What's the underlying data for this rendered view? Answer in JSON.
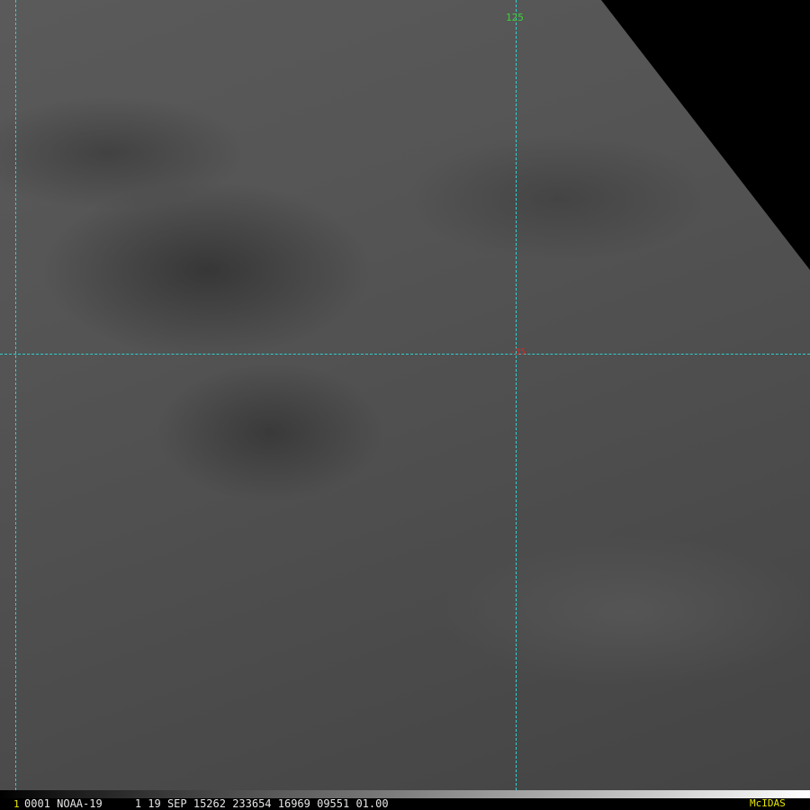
{
  "map": {
    "grid_lon_label": "125",
    "grid_lat_label": "-35"
  },
  "footer": {
    "frame_number": "1",
    "caption": "0001 NOAA-19     1 19 SEP 15262 233654 16969 09551 01.00",
    "brand": "McIDAS"
  },
  "colors": {
    "grid": "#2fd0d0",
    "lon_label": "#3cd23c",
    "lat_label": "#d02a2a",
    "brand": "#e8e800"
  }
}
